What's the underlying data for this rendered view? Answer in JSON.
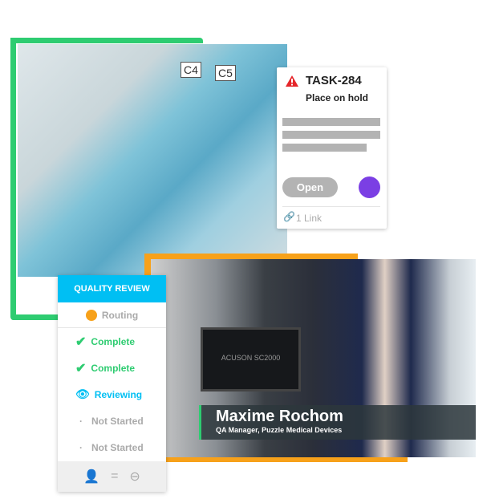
{
  "colors": {
    "green": "#2ecc71",
    "orange": "#f7a11a",
    "cyan": "#00bff3",
    "purple": "#7b3fe4",
    "alert": "#e5262a"
  },
  "photo1": {
    "tags": [
      "C4",
      "C5"
    ]
  },
  "task_card": {
    "icon": "warning-icon",
    "id": "TASK-284",
    "title": "Place on hold",
    "status_button": "Open",
    "assignee_color": "#7b3fe4",
    "links": "1 Link"
  },
  "video": {
    "screen_text": "ACUSON SC2000",
    "name": "Maxime Rochom",
    "role": "QA Manager, Puzzle Medical Devices"
  },
  "quality_review": {
    "title": "QUALITY REVIEW",
    "routing": "Routing",
    "steps": [
      {
        "status": "Complete",
        "icon": "check-icon"
      },
      {
        "status": "Complete",
        "icon": "check-icon"
      },
      {
        "status": "Reviewing",
        "icon": "eye-icon"
      },
      {
        "status": "Not Started",
        "icon": "dot-icon"
      },
      {
        "status": "Not Started",
        "icon": "dot-icon"
      }
    ],
    "footer_icons": [
      "add-user-icon",
      "equals-icon",
      "minus-circle-icon"
    ]
  }
}
